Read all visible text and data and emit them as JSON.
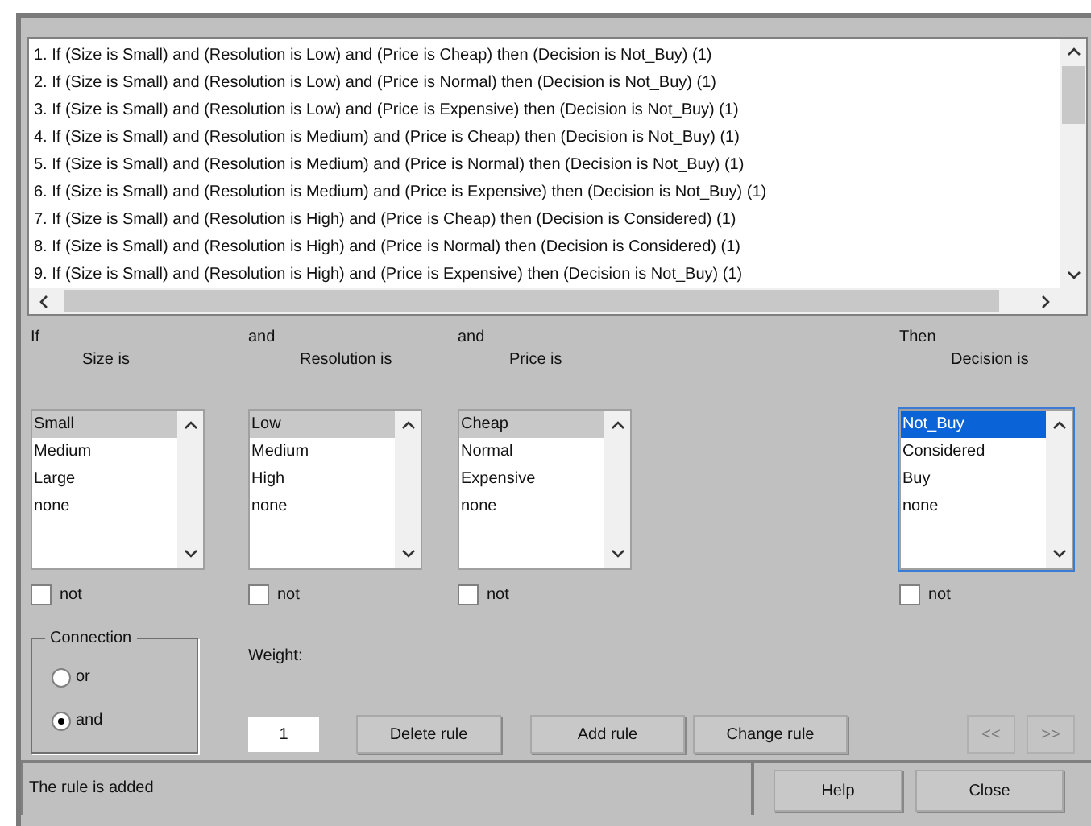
{
  "rules": [
    "1. If (Size is Small) and (Resolution is Low) and (Price is Cheap) then (Decision is Not_Buy) (1)",
    "2. If (Size is Small) and (Resolution is Low) and (Price is Normal) then (Decision is Not_Buy) (1)",
    "3. If (Size is Small) and (Resolution is Low) and (Price is Expensive) then (Decision is Not_Buy) (1)",
    "4. If (Size is Small) and (Resolution is Medium) and (Price is Cheap) then (Decision is Not_Buy) (1)",
    "5. If (Size is Small) and (Resolution is Medium) and (Price is Normal) then (Decision is Not_Buy) (1)",
    "6. If (Size is Small) and (Resolution is Medium) and (Price is Expensive) then (Decision is Not_Buy) (1)",
    "7. If (Size is Small) and (Resolution is High) and (Price is Cheap) then (Decision is Considered) (1)",
    "8. If (Size is Small) and (Resolution is High) and (Price is Normal) then (Decision is Considered) (1)",
    "9. If (Size is Small) and (Resolution is High) and (Price is Expensive) then (Decision is Not_Buy) (1)"
  ],
  "variables": [
    {
      "kind": "input",
      "connector": "If",
      "label": "Size is",
      "focused": false,
      "not_label": "not",
      "not_checked": false,
      "options": [
        {
          "label": "Small",
          "selected": true
        },
        {
          "label": "Medium",
          "selected": false
        },
        {
          "label": "Large",
          "selected": false
        },
        {
          "label": "none",
          "selected": false
        }
      ]
    },
    {
      "kind": "input",
      "connector": "and",
      "label": "Resolution is",
      "focused": false,
      "not_label": "not",
      "not_checked": false,
      "options": [
        {
          "label": "Low",
          "selected": true
        },
        {
          "label": "Medium",
          "selected": false
        },
        {
          "label": "High",
          "selected": false
        },
        {
          "label": "none",
          "selected": false
        }
      ]
    },
    {
      "kind": "input",
      "connector": "and",
      "label": "Price is",
      "focused": false,
      "not_label": "not",
      "not_checked": false,
      "options": [
        {
          "label": "Cheap",
          "selected": true
        },
        {
          "label": "Normal",
          "selected": false
        },
        {
          "label": "Expensive",
          "selected": false
        },
        {
          "label": "none",
          "selected": false
        }
      ]
    },
    {
      "kind": "output",
      "connector": "Then",
      "label": "Decision is",
      "focused": true,
      "not_label": "not",
      "not_checked": false,
      "options": [
        {
          "label": "Not_Buy",
          "selected": true
        },
        {
          "label": "Considered",
          "selected": false
        },
        {
          "label": "Buy",
          "selected": false
        },
        {
          "label": "none",
          "selected": false
        }
      ]
    }
  ],
  "connection": {
    "title": "Connection",
    "options": [
      {
        "label": "or",
        "selected": false
      },
      {
        "label": "and",
        "selected": true
      }
    ]
  },
  "weight": {
    "label": "Weight:",
    "value": "1"
  },
  "rule_buttons": [
    {
      "label": "Delete rule"
    },
    {
      "label": "Add rule"
    },
    {
      "label": "Change rule"
    }
  ],
  "nav_buttons": [
    {
      "label": "<<",
      "disabled": true
    },
    {
      "label": ">>",
      "disabled": true
    }
  ],
  "status": "The rule is added",
  "footer_buttons": [
    {
      "label": "Help"
    },
    {
      "label": "Close"
    }
  ]
}
